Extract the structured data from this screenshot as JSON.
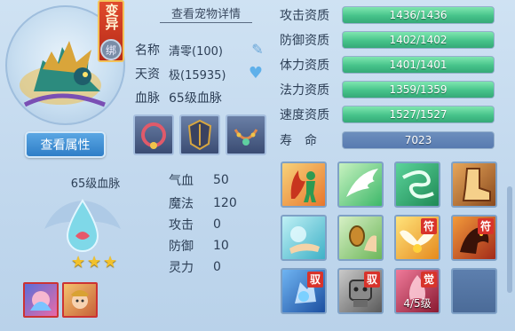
{
  "header": {
    "mutation_label": "变异",
    "lock_label": "绑",
    "detail_link": "查看宠物详情"
  },
  "pet": {
    "name_label": "名称",
    "name_value": "清零(100)",
    "aptitude_label": "天资",
    "aptitude_value": "极(15935)",
    "bloodline_label": "血脉",
    "bloodline_value": "65级血脉",
    "view_attributes_button": "查看属性",
    "bloodline_title": "65级血脉",
    "stars": 3
  },
  "equipment": [
    {
      "icon": "necklace-icon"
    },
    {
      "icon": "armor-icon"
    },
    {
      "icon": "chain-icon"
    }
  ],
  "basic_stats": [
    {
      "label": "气血",
      "value": "50"
    },
    {
      "label": "魔法",
      "value": "120"
    },
    {
      "label": "攻击",
      "value": "0"
    },
    {
      "label": "防御",
      "value": "10"
    },
    {
      "label": "灵力",
      "value": "0"
    }
  ],
  "aptitudes": [
    {
      "label": "攻击资质",
      "text": "1436/1436",
      "fill": 1.0
    },
    {
      "label": "防御资质",
      "text": "1402/1402",
      "fill": 1.0
    },
    {
      "label": "体力资质",
      "text": "1401/1401",
      "fill": 1.0
    },
    {
      "label": "法力资质",
      "text": "1359/1359",
      "fill": 1.0
    },
    {
      "label": "速度资质",
      "text": "1527/1527",
      "fill": 1.0
    }
  ],
  "life": {
    "label": "寿命",
    "value": "7023"
  },
  "skills": [
    {
      "icon": "fire-figure-icon"
    },
    {
      "icon": "wing-icon"
    },
    {
      "icon": "wind-swirl-icon"
    },
    {
      "icon": "boot-icon"
    },
    {
      "icon": "water-hand-icon"
    },
    {
      "icon": "shield-hand-icon"
    },
    {
      "icon": "holy-wings-icon",
      "badge": "符"
    },
    {
      "icon": "beast-roar-icon",
      "badge": "符"
    },
    {
      "icon": "ice-crystal-icon",
      "badge": "驭"
    },
    {
      "icon": "stone-golem-icon",
      "badge": "驭"
    },
    {
      "icon": "blood-spirit-icon",
      "badge": "觉",
      "caption": "4/5级"
    },
    {
      "icon": "empty-slot-icon"
    }
  ],
  "colors": {
    "accent_green": "#46c38a",
    "button_blue": "#2f7ec7",
    "badge_red": "#d8332b"
  }
}
